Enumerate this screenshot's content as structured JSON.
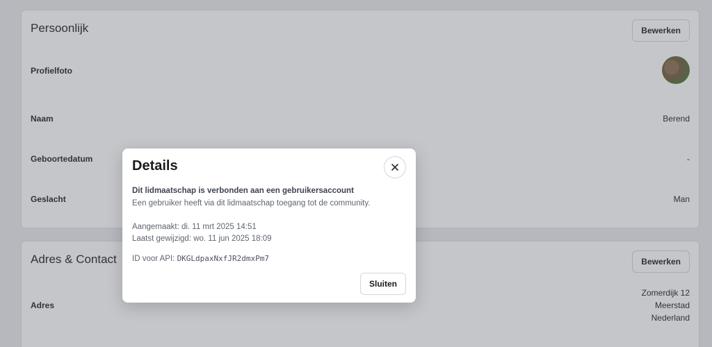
{
  "personal": {
    "title": "Persoonlijk",
    "edit_label": "Bewerken",
    "rows": [
      {
        "label": "Profielfoto",
        "value": ""
      },
      {
        "label": "Naam",
        "value": "Berend"
      },
      {
        "label": "Geboortedatum",
        "value": "-"
      },
      {
        "label": "Geslacht",
        "value": "Man"
      }
    ]
  },
  "address": {
    "title": "Adres & Contact",
    "edit_label": "Bewerken",
    "rows": [
      {
        "label": "Adres",
        "lines": [
          "Zomerdijk 12",
          "Meerstad",
          "Nederland"
        ]
      }
    ]
  },
  "modal": {
    "title": "Details",
    "linked_heading": "Dit lidmaatschap is verbonden aan een gebruikersaccount",
    "linked_desc": "Een gebruiker heeft via dit lidmaatschap toegang tot de community.",
    "created": "Aangemaakt: di. 11 mrt 2025 14:51",
    "modified": "Laatst gewijzigd: wo. 11 jun 2025 18:09",
    "api_label": "ID voor API:",
    "api_id": "DKGLdpaxNxfJR2dmxPm7",
    "close_label": "Sluiten"
  }
}
